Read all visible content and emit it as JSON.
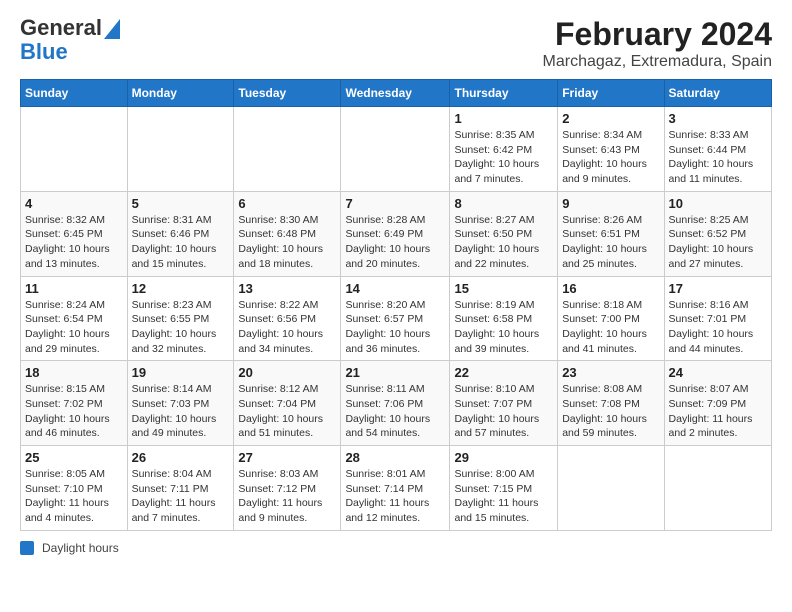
{
  "logo": {
    "general": "General",
    "blue": "Blue",
    "aria": "GeneralBlue logo"
  },
  "title": "February 2024",
  "subtitle": "Marchagaz, Extremadura, Spain",
  "days_header": [
    "Sunday",
    "Monday",
    "Tuesday",
    "Wednesday",
    "Thursday",
    "Friday",
    "Saturday"
  ],
  "weeks": [
    [
      {
        "num": "",
        "info": ""
      },
      {
        "num": "",
        "info": ""
      },
      {
        "num": "",
        "info": ""
      },
      {
        "num": "",
        "info": ""
      },
      {
        "num": "1",
        "info": "Sunrise: 8:35 AM\nSunset: 6:42 PM\nDaylight: 10 hours\nand 7 minutes."
      },
      {
        "num": "2",
        "info": "Sunrise: 8:34 AM\nSunset: 6:43 PM\nDaylight: 10 hours\nand 9 minutes."
      },
      {
        "num": "3",
        "info": "Sunrise: 8:33 AM\nSunset: 6:44 PM\nDaylight: 10 hours\nand 11 minutes."
      }
    ],
    [
      {
        "num": "4",
        "info": "Sunrise: 8:32 AM\nSunset: 6:45 PM\nDaylight: 10 hours\nand 13 minutes."
      },
      {
        "num": "5",
        "info": "Sunrise: 8:31 AM\nSunset: 6:46 PM\nDaylight: 10 hours\nand 15 minutes."
      },
      {
        "num": "6",
        "info": "Sunrise: 8:30 AM\nSunset: 6:48 PM\nDaylight: 10 hours\nand 18 minutes."
      },
      {
        "num": "7",
        "info": "Sunrise: 8:28 AM\nSunset: 6:49 PM\nDaylight: 10 hours\nand 20 minutes."
      },
      {
        "num": "8",
        "info": "Sunrise: 8:27 AM\nSunset: 6:50 PM\nDaylight: 10 hours\nand 22 minutes."
      },
      {
        "num": "9",
        "info": "Sunrise: 8:26 AM\nSunset: 6:51 PM\nDaylight: 10 hours\nand 25 minutes."
      },
      {
        "num": "10",
        "info": "Sunrise: 8:25 AM\nSunset: 6:52 PM\nDaylight: 10 hours\nand 27 minutes."
      }
    ],
    [
      {
        "num": "11",
        "info": "Sunrise: 8:24 AM\nSunset: 6:54 PM\nDaylight: 10 hours\nand 29 minutes."
      },
      {
        "num": "12",
        "info": "Sunrise: 8:23 AM\nSunset: 6:55 PM\nDaylight: 10 hours\nand 32 minutes."
      },
      {
        "num": "13",
        "info": "Sunrise: 8:22 AM\nSunset: 6:56 PM\nDaylight: 10 hours\nand 34 minutes."
      },
      {
        "num": "14",
        "info": "Sunrise: 8:20 AM\nSunset: 6:57 PM\nDaylight: 10 hours\nand 36 minutes."
      },
      {
        "num": "15",
        "info": "Sunrise: 8:19 AM\nSunset: 6:58 PM\nDaylight: 10 hours\nand 39 minutes."
      },
      {
        "num": "16",
        "info": "Sunrise: 8:18 AM\nSunset: 7:00 PM\nDaylight: 10 hours\nand 41 minutes."
      },
      {
        "num": "17",
        "info": "Sunrise: 8:16 AM\nSunset: 7:01 PM\nDaylight: 10 hours\nand 44 minutes."
      }
    ],
    [
      {
        "num": "18",
        "info": "Sunrise: 8:15 AM\nSunset: 7:02 PM\nDaylight: 10 hours\nand 46 minutes."
      },
      {
        "num": "19",
        "info": "Sunrise: 8:14 AM\nSunset: 7:03 PM\nDaylight: 10 hours\nand 49 minutes."
      },
      {
        "num": "20",
        "info": "Sunrise: 8:12 AM\nSunset: 7:04 PM\nDaylight: 10 hours\nand 51 minutes."
      },
      {
        "num": "21",
        "info": "Sunrise: 8:11 AM\nSunset: 7:06 PM\nDaylight: 10 hours\nand 54 minutes."
      },
      {
        "num": "22",
        "info": "Sunrise: 8:10 AM\nSunset: 7:07 PM\nDaylight: 10 hours\nand 57 minutes."
      },
      {
        "num": "23",
        "info": "Sunrise: 8:08 AM\nSunset: 7:08 PM\nDaylight: 10 hours\nand 59 minutes."
      },
      {
        "num": "24",
        "info": "Sunrise: 8:07 AM\nSunset: 7:09 PM\nDaylight: 11 hours\nand 2 minutes."
      }
    ],
    [
      {
        "num": "25",
        "info": "Sunrise: 8:05 AM\nSunset: 7:10 PM\nDaylight: 11 hours\nand 4 minutes."
      },
      {
        "num": "26",
        "info": "Sunrise: 8:04 AM\nSunset: 7:11 PM\nDaylight: 11 hours\nand 7 minutes."
      },
      {
        "num": "27",
        "info": "Sunrise: 8:03 AM\nSunset: 7:12 PM\nDaylight: 11 hours\nand 9 minutes."
      },
      {
        "num": "28",
        "info": "Sunrise: 8:01 AM\nSunset: 7:14 PM\nDaylight: 11 hours\nand 12 minutes."
      },
      {
        "num": "29",
        "info": "Sunrise: 8:00 AM\nSunset: 7:15 PM\nDaylight: 11 hours\nand 15 minutes."
      },
      {
        "num": "",
        "info": ""
      },
      {
        "num": "",
        "info": ""
      }
    ]
  ],
  "footer": {
    "daylight_label": "Daylight hours"
  },
  "accent_color": "#2176c7"
}
